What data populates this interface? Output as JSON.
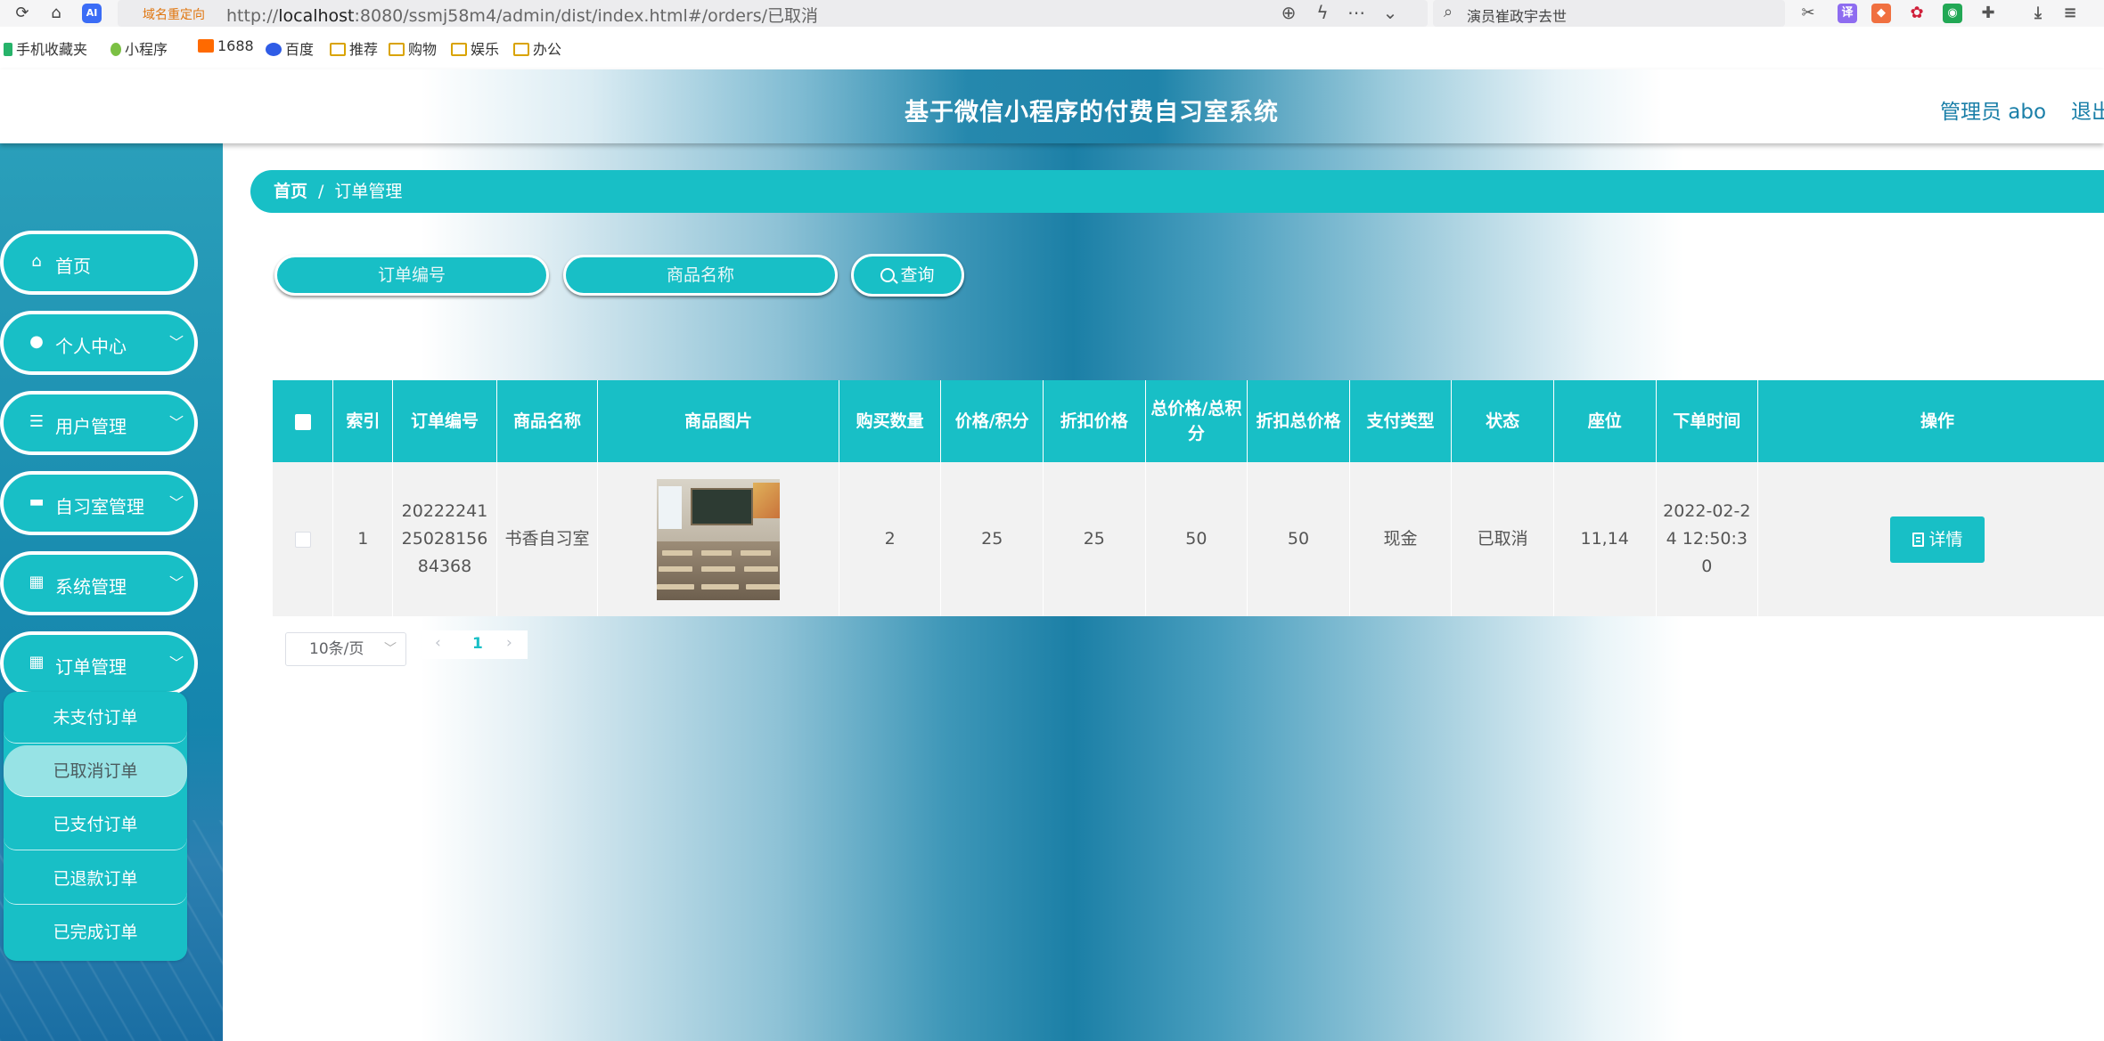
{
  "browser": {
    "redirect_tag": "域名重定向",
    "url_prefix": "http://",
    "url_host": "localhost",
    "url_rest": ":8080/ssmj58m4/admin/dist/index.html#/orders/已取消",
    "search_text": "演员崔政宇去世",
    "ai_badge": "AI",
    "bookmarks": [
      {
        "label": "手机收藏夹",
        "icon": "phone-icon"
      },
      {
        "label": "小程序",
        "icon": "mini-program-icon"
      },
      {
        "label": "1688",
        "icon": "1688-icon"
      },
      {
        "label": "百度",
        "icon": "baidu-icon"
      },
      {
        "label": "推荐",
        "icon": "folder-icon"
      },
      {
        "label": "购物",
        "icon": "folder-icon"
      },
      {
        "label": "娱乐",
        "icon": "folder-icon"
      },
      {
        "label": "办公",
        "icon": "folder-icon"
      }
    ]
  },
  "header": {
    "title": "基于微信小程序的付费自习室系统",
    "admin": "管理员 abo",
    "logout": "退出"
  },
  "sidebar": {
    "items": [
      {
        "label": "首页",
        "icon": "home-icon"
      },
      {
        "label": "个人中心",
        "icon": "user-icon"
      },
      {
        "label": "用户管理",
        "icon": "list-icon"
      },
      {
        "label": "自习室管理",
        "icon": "book-icon"
      },
      {
        "label": "系统管理",
        "icon": "grid-icon"
      },
      {
        "label": "订单管理",
        "icon": "grid-icon"
      }
    ],
    "submenu": [
      {
        "label": "未支付订单"
      },
      {
        "label": "已取消订单"
      },
      {
        "label": "已支付订单"
      },
      {
        "label": "已退款订单"
      },
      {
        "label": "已完成订单"
      }
    ]
  },
  "breadcrumb": {
    "home": "首页",
    "separator": "/",
    "current": "订单管理"
  },
  "search": {
    "order_no_placeholder": "订单编号",
    "product_name_placeholder": "商品名称",
    "query_label": "查询"
  },
  "table": {
    "headers": {
      "index": "索引",
      "order_no": "订单编号",
      "product_name": "商品名称",
      "product_image": "商品图片",
      "quantity": "购买数量",
      "price": "价格/积分",
      "discount_price": "折扣价格",
      "total": "总价格/总积分",
      "discount_total": "折扣总价格",
      "pay_type": "支付类型",
      "status": "状态",
      "seat": "座位",
      "order_time": "下单时间",
      "actions": "操作"
    },
    "rows": [
      {
        "index": "1",
        "order_no": "2022224125028156 84368",
        "product_name": "书香自习室",
        "quantity": "2",
        "price": "25",
        "discount_price": "25",
        "total": "50",
        "discount_total": "50",
        "pay_type": "现金",
        "status": "已取消",
        "seat": "11,14",
        "order_time": "2022-02-24 12:50:30",
        "detail_label": "详情"
      }
    ]
  },
  "pagination": {
    "page_size": "10条/页",
    "current_page": "1"
  },
  "colors": {
    "accent": "#18bfc6",
    "header_text": "#1a7fa8"
  }
}
